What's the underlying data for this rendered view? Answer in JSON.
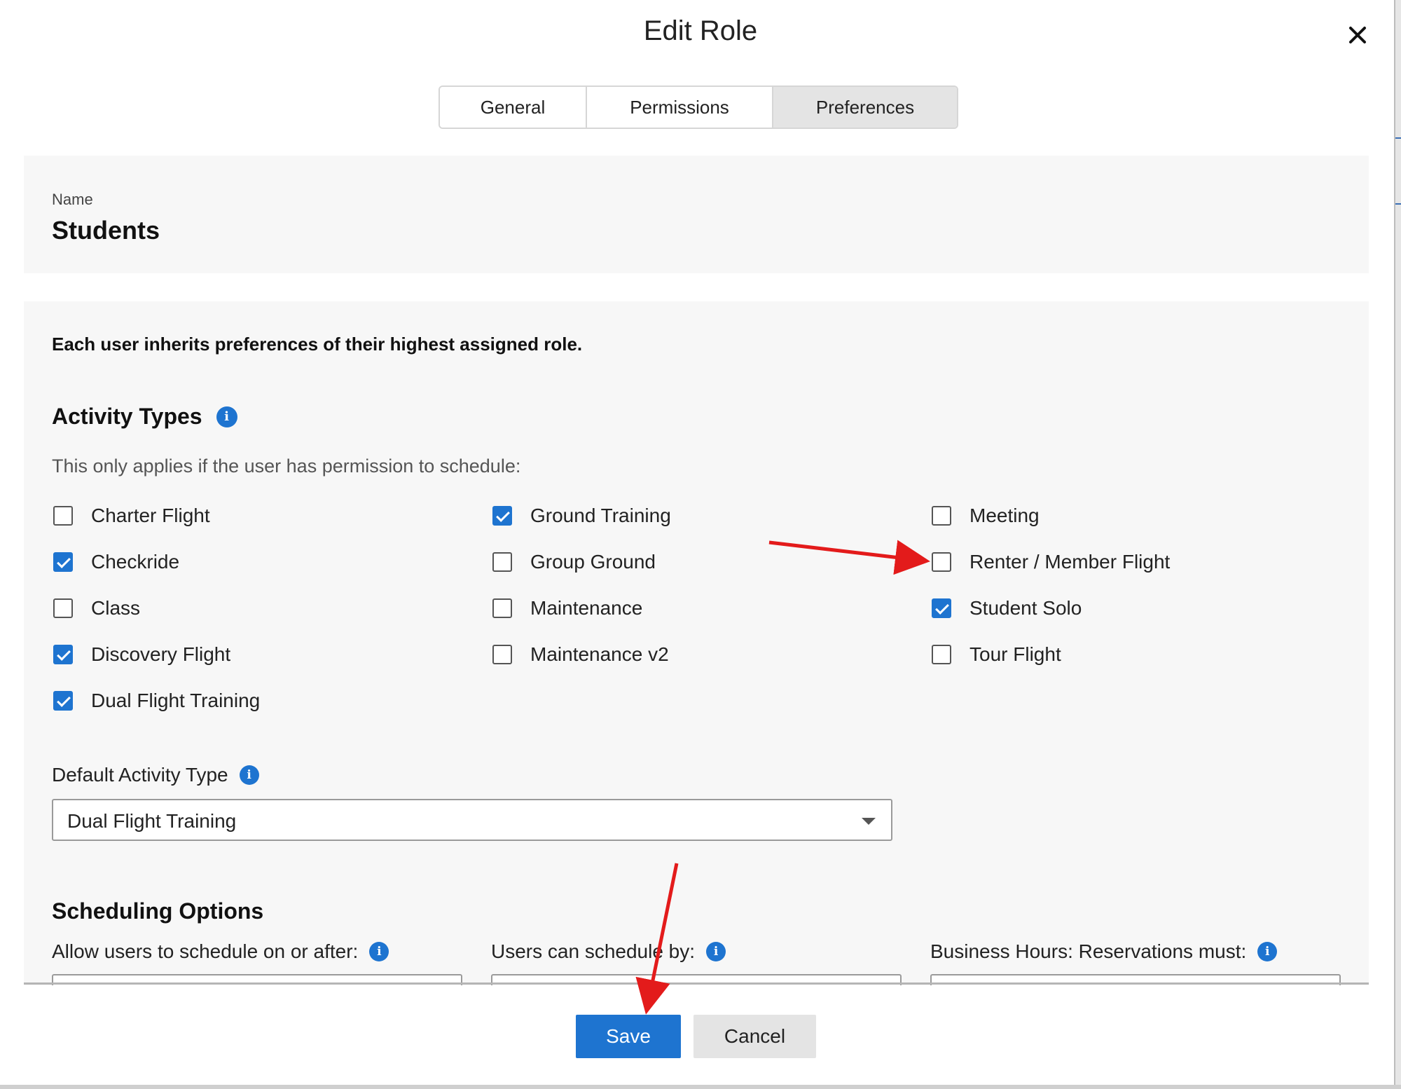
{
  "dialog": {
    "title": "Edit Role",
    "close_icon": "close-icon"
  },
  "tabs": [
    {
      "label": "General",
      "active": false
    },
    {
      "label": "Permissions",
      "active": false
    },
    {
      "label": "Preferences",
      "active": true
    }
  ],
  "name_section": {
    "label": "Name",
    "value": "Students"
  },
  "preferences": {
    "inherit_note": "Each user inherits preferences of their highest assigned role.",
    "activity_types": {
      "title": "Activity Types",
      "subtitle": "This only applies if the user has permission to schedule:",
      "columns": [
        [
          {
            "label": "Charter Flight",
            "checked": false
          },
          {
            "label": "Checkride",
            "checked": true
          },
          {
            "label": "Class",
            "checked": false
          },
          {
            "label": "Discovery Flight",
            "checked": true
          },
          {
            "label": "Dual Flight Training",
            "checked": true
          }
        ],
        [
          {
            "label": "Ground Training",
            "checked": true
          },
          {
            "label": "Group Ground",
            "checked": false
          },
          {
            "label": "Maintenance",
            "checked": false
          },
          {
            "label": "Maintenance v2",
            "checked": false
          }
        ],
        [
          {
            "label": "Meeting",
            "checked": false
          },
          {
            "label": "Renter / Member Flight",
            "checked": false
          },
          {
            "label": "Student Solo",
            "checked": true
          },
          {
            "label": "Tour Flight",
            "checked": false
          }
        ]
      ]
    },
    "default_activity": {
      "label": "Default Activity Type",
      "value": "Dual Flight Training"
    },
    "scheduling": {
      "title": "Scheduling Options",
      "fields": [
        {
          "label": "Allow users to schedule on or after:"
        },
        {
          "label": "Users can schedule by:"
        },
        {
          "label": "Business Hours: Reservations must:"
        }
      ]
    }
  },
  "footer": {
    "save_label": "Save",
    "cancel_label": "Cancel"
  },
  "colors": {
    "accent": "#1e74d0",
    "annotation_arrow": "#e31b1b",
    "panel_bg": "#f7f7f7",
    "active_tab_bg": "#e4e4e4"
  }
}
